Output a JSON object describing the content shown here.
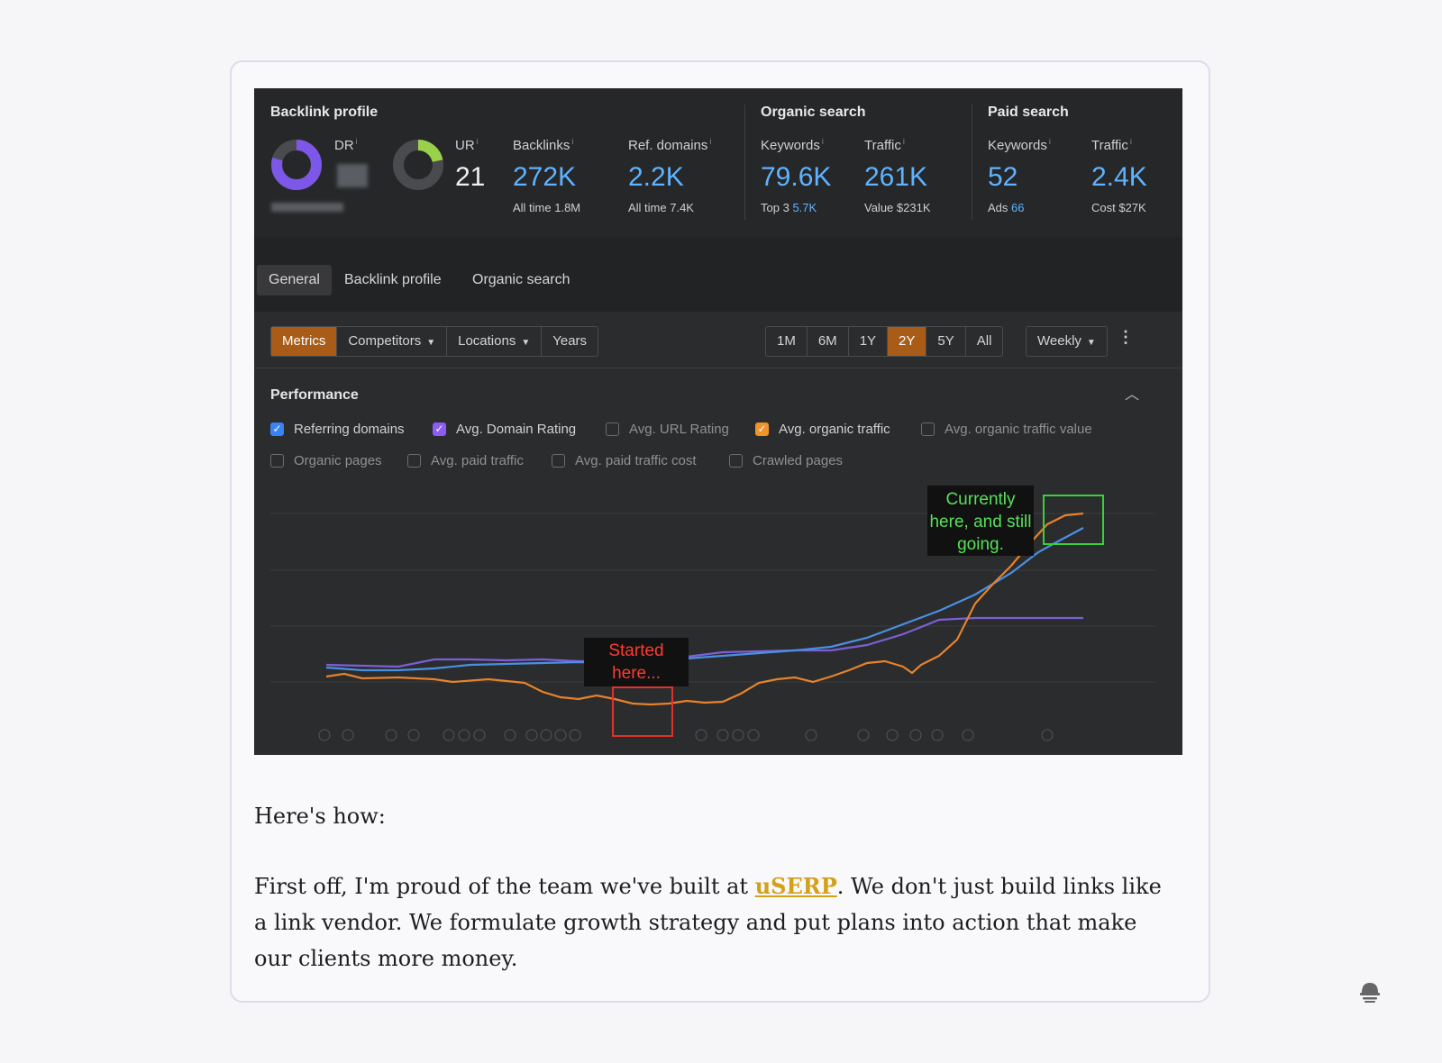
{
  "backlink": {
    "title": "Backlink profile",
    "dr_label": "DR",
    "ur_label": "UR",
    "ur_value": "21",
    "backlinks_label": "Backlinks",
    "backlinks_value": "272K",
    "backlinks_sub": "All time 1.8M",
    "refdomains_label": "Ref. domains",
    "refdomains_value": "2.2K",
    "refdomains_sub": "All time 7.4K"
  },
  "organic": {
    "title": "Organic search",
    "keywords_label": "Keywords",
    "keywords_value": "79.6K",
    "keywords_sub_prefix": "Top 3",
    "keywords_sub_value": "5.7K",
    "traffic_label": "Traffic",
    "traffic_value": "261K",
    "traffic_sub": "Value $231K"
  },
  "paid": {
    "title": "Paid search",
    "keywords_label": "Keywords",
    "keywords_value": "52",
    "keywords_sub_prefix": "Ads",
    "keywords_sub_value": "66",
    "traffic_label": "Traffic",
    "traffic_value": "2.4K",
    "traffic_sub": "Cost $27K"
  },
  "tabs": [
    "General",
    "Backlink profile",
    "Organic search"
  ],
  "toolbar": {
    "metrics": "Metrics",
    "competitors": "Competitors",
    "locations": "Locations",
    "years": "Years",
    "ranges": [
      "1M",
      "6M",
      "1Y",
      "2Y",
      "5Y",
      "All"
    ],
    "active_range": "2Y",
    "interval": "Weekly"
  },
  "performance": {
    "title": "Performance",
    "checkboxes": [
      {
        "label": "Referring domains",
        "checked": true,
        "color": "#3b82f6"
      },
      {
        "label": "Avg. Domain Rating",
        "checked": true,
        "color": "#8b5cf6"
      },
      {
        "label": "Avg. URL Rating",
        "checked": false
      },
      {
        "label": "Avg. organic traffic",
        "checked": true,
        "color": "#f0932b"
      },
      {
        "label": "Avg. organic traffic value",
        "checked": false
      },
      {
        "label": "Organic pages",
        "checked": false
      },
      {
        "label": "Avg. paid traffic",
        "checked": false
      },
      {
        "label": "Avg. paid traffic cost",
        "checked": false
      },
      {
        "label": "Crawled pages",
        "checked": false
      }
    ]
  },
  "annotations": {
    "current": "Currently here, and still going.",
    "start": "Started here..."
  },
  "colors": {
    "referring_domains": "#4a90e2",
    "domain_rating": "#7b5fd6",
    "organic_traffic": "#e8822a",
    "highlight_green": "#39d13a",
    "highlight_red": "#e0322a",
    "link": "#d4a017"
  },
  "article": {
    "heading": "Here's how:",
    "para_before": "First off, I'm proud of the team we've built at ",
    "link_text": "uSERP",
    "para_after": ". We don't just build links like a link vendor. We formulate growth strategy and put plans into action that make our clients more money."
  },
  "icons": {
    "corner": "hat-icon"
  }
}
